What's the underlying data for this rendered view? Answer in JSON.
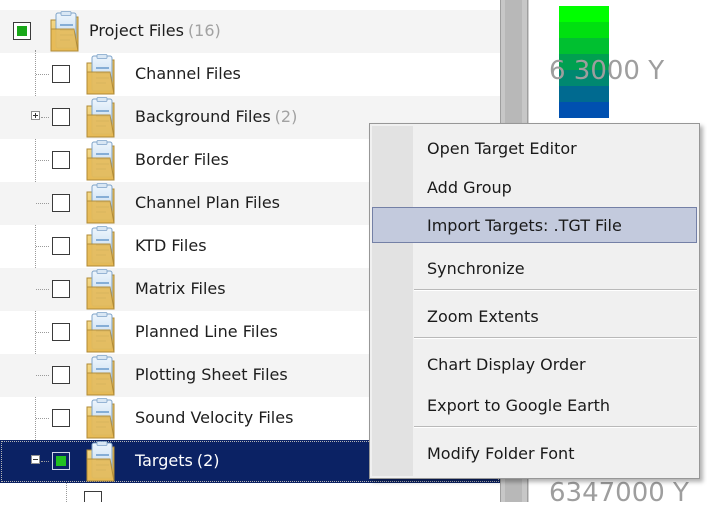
{
  "tree": {
    "root": {
      "label": "Project Files",
      "count": "(16)"
    },
    "items": [
      {
        "label": "Channel Files",
        "count": "",
        "expander": "none"
      },
      {
        "label": "Background Files",
        "count": "(2)",
        "expander": "plus"
      },
      {
        "label": "Border Files",
        "count": "",
        "expander": "none"
      },
      {
        "label": "Channel Plan Files",
        "count": "",
        "expander": "none"
      },
      {
        "label": "KTD Files",
        "count": "",
        "expander": "none"
      },
      {
        "label": "Matrix Files",
        "count": "",
        "expander": "none"
      },
      {
        "label": "Planned Line Files",
        "count": "",
        "expander": "none"
      },
      {
        "label": "Plotting Sheet Files",
        "count": "",
        "expander": "none"
      },
      {
        "label": "Sound Velocity Files",
        "count": "",
        "expander": "none"
      },
      {
        "label": "Targets",
        "count": "(2)",
        "expander": "minus",
        "selected": true
      }
    ]
  },
  "map": {
    "top_label": "6 3000 Y",
    "bottom_label": "6347000 Y",
    "depth_colors": [
      "#00ff00",
      "#00e010",
      "#00c030",
      "#00a050",
      "#008870",
      "#006a90",
      "#0050b0"
    ]
  },
  "context_menu": {
    "items": [
      {
        "label": "Open Target Editor"
      },
      {
        "label": "Add Group"
      },
      {
        "label": "Import Targets: .TGT File",
        "highlighted": true
      },
      {
        "label": "Synchronize"
      },
      {
        "separator": true
      },
      {
        "label": "Zoom Extents"
      },
      {
        "separator": true
      },
      {
        "label": "Chart Display Order"
      },
      {
        "label": "Export to Google Earth"
      },
      {
        "separator": true
      },
      {
        "label": "Modify Folder Font"
      }
    ]
  },
  "colors": {
    "selection": "#0b2264",
    "menu_highlight": "#c3cadd",
    "checkbox_fill": "#1aa81a"
  }
}
